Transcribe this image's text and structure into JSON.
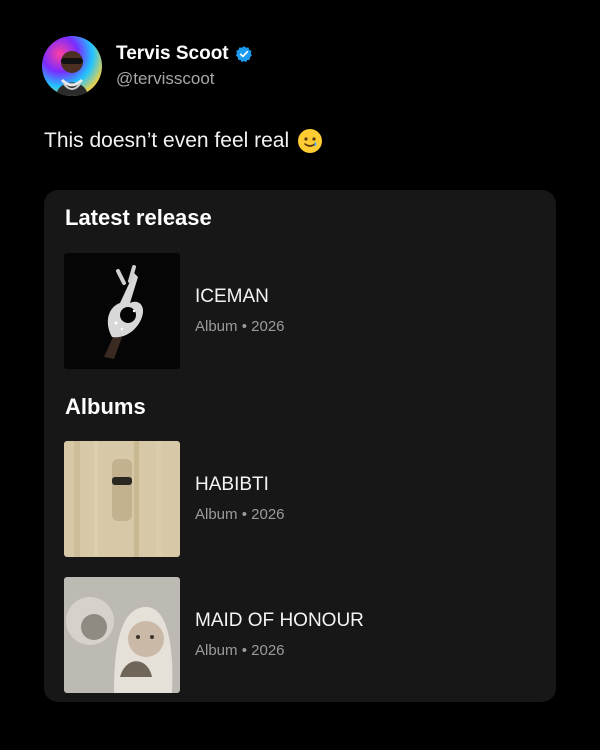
{
  "author": {
    "display_name": "Tervis Scoot",
    "handle": "@tervisscoot",
    "verified_icon": "verified-badge-icon",
    "accent_color": "#1d9bf0"
  },
  "tweet": {
    "text": "This doesn’t even feel real",
    "emoji_icon": "smiling-face-with-tear-emoji"
  },
  "card": {
    "latest_release_title": "Latest release",
    "albums_title": "Albums",
    "latest_release": {
      "title": "ICEMAN",
      "type": "Album",
      "separator": "•",
      "year": "2026"
    },
    "albums": [
      {
        "title": "HABIBTI",
        "type": "Album",
        "separator": "•",
        "year": "2026"
      },
      {
        "title": "MAID OF HONOUR",
        "type": "Album",
        "separator": "•",
        "year": "2026"
      }
    ]
  }
}
